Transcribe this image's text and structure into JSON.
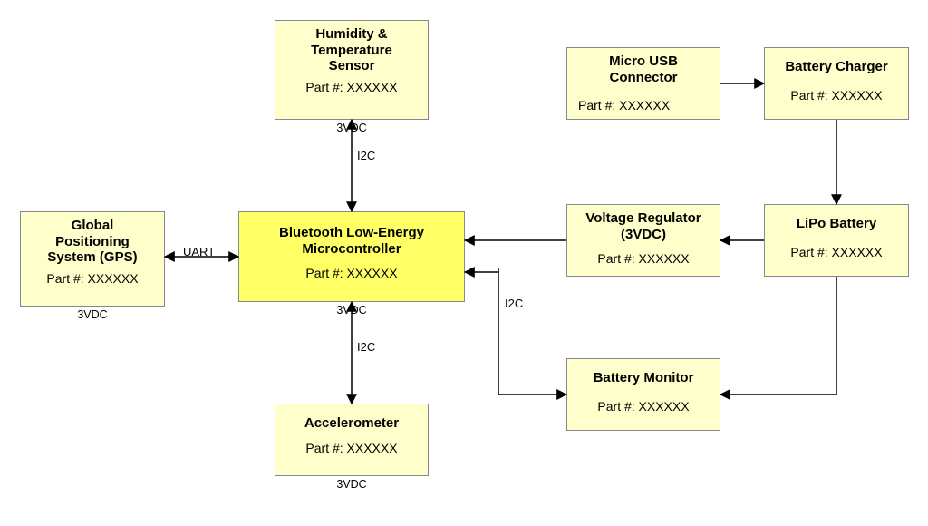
{
  "boxes": {
    "sensor": {
      "title": "Humidity &\nTemperature\nSensor",
      "part": "Part #: XXXXXX",
      "volt": "3VDC"
    },
    "gps": {
      "title": "Global\nPositioning\nSystem (GPS)",
      "part": "Part #: XXXXXX",
      "volt": "3VDC"
    },
    "mcu": {
      "title": "Bluetooth Low-Energy\nMicrocontroller",
      "part": "Part #: XXXXXX",
      "volt": "3VDC"
    },
    "accel": {
      "title": "Accelerometer",
      "part": "Part #: XXXXXX",
      "volt": "3VDC"
    },
    "usb": {
      "title": "Micro USB\nConnector",
      "part": "Part #: XXXXXX"
    },
    "charger": {
      "title": "Battery Charger",
      "part": "Part #: XXXXXX"
    },
    "vreg": {
      "title": "Voltage Regulator\n(3VDC)",
      "part": "Part #: XXXXXX"
    },
    "lipo": {
      "title": "LiPo Battery",
      "part": "Part #: XXXXXX"
    },
    "batmon": {
      "title": "Battery Monitor",
      "part": "Part #: XXXXXX"
    }
  },
  "edges": {
    "uart": "UART",
    "i2c": "I2C"
  }
}
